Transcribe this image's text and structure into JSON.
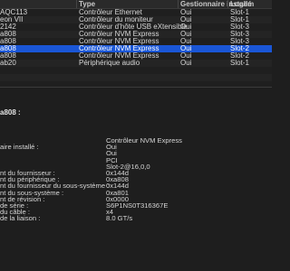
{
  "table": {
    "headers": [
      "",
      "Type",
      "Gestionnaire installé",
      "Logem"
    ],
    "rows": [
      {
        "name": "AQC113",
        "type": "Contrôleur Ethernet",
        "installed": "Oui",
        "slot": "Slot-1"
      },
      {
        "name": "eon VII",
        "type": "Contrôleur du moniteur",
        "installed": "Oui",
        "slot": "Slot-1"
      },
      {
        "name": "2142",
        "type": "Contrôleur d’hôte USB eXtensible",
        "installed": "Oui",
        "slot": "Slot-3"
      },
      {
        "name": "a808",
        "type": "Contrôleur NVM Express",
        "installed": "Oui",
        "slot": "Slot-3"
      },
      {
        "name": "a808",
        "type": "Contrôleur NVM Express",
        "installed": "Oui",
        "slot": "Slot-3"
      },
      {
        "name": "a808",
        "type": "Contrôleur NVM Express",
        "installed": "Oui",
        "slot": "Slot-2"
      },
      {
        "name": "a808",
        "type": "Contrôleur NVM Express",
        "installed": "Oui",
        "slot": "Slot-2"
      },
      {
        "name": "ab20",
        "type": "Périphérique audio",
        "installed": "Oui",
        "slot": "Slot-1"
      }
    ],
    "selected_index": 5
  },
  "detail": {
    "title": "a808 :",
    "fields": [
      {
        "label": "",
        "value": "Contrôleur NVM Express"
      },
      {
        "label": "aire installé :",
        "value": "Oui"
      },
      {
        "label": "",
        "value": "Oui"
      },
      {
        "label": "",
        "value": "PCI"
      },
      {
        "label": "",
        "value": "Slot-2@16,0,0"
      },
      {
        "label": "nt du fournisseur :",
        "value": "0x144d"
      },
      {
        "label": "nt du périphérique :",
        "value": "0xa808"
      },
      {
        "label": "nt du fournisseur du sous-système :",
        "value": "0x144d"
      },
      {
        "label": "nt du sous-système :",
        "value": "0xa801"
      },
      {
        "label": "nt de révision :",
        "value": "0x0000"
      },
      {
        "label": "de série :",
        "value": "S6P1NS0T316367E"
      },
      {
        "label": "du câble :",
        "value": "x4"
      },
      {
        "label": "de la liaison :",
        "value": "8.0 GT/s"
      }
    ]
  }
}
